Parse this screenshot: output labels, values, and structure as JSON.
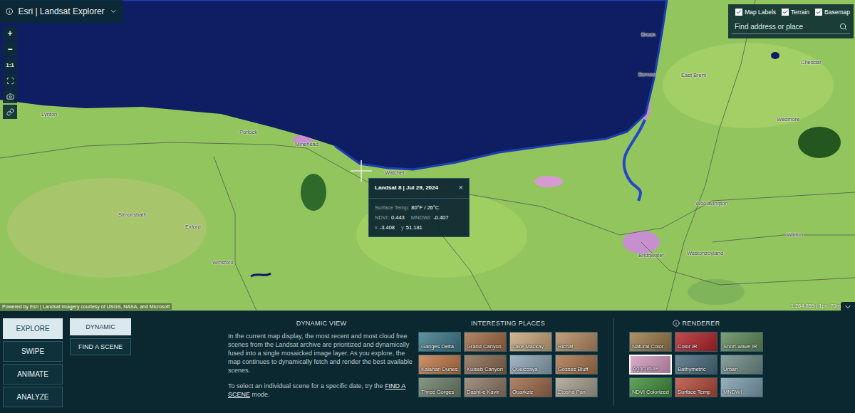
{
  "app": {
    "title": "Esri | Landsat Explorer"
  },
  "zoom_controls": [
    "+",
    "−",
    "1:1"
  ],
  "layers": [
    {
      "label": "Map Labels",
      "checked": true
    },
    {
      "label": "Terrain",
      "checked": true
    },
    {
      "label": "Basemap",
      "checked": true
    }
  ],
  "search": {
    "placeholder": "Find address or place"
  },
  "map_labels": [
    "Lynton",
    "Porlock",
    "Minehead",
    "Watchet",
    "Exford",
    "Simonsbath",
    "Winsford",
    "Bridgwater",
    "Westonzoyland",
    "Woolavington",
    "Walton",
    "Brean",
    "Berrow",
    "Wedmore",
    "Cheddar",
    "East Brent"
  ],
  "popup": {
    "title": "Landsat 8 | Jul 29, 2024",
    "close": "×",
    "surface_temp_label": "Surface Temp:",
    "surface_temp": "80°F / 26°C",
    "ndvi_label": "NDVI:",
    "ndvi": "0.443",
    "mndwi_label": "MNDWI:",
    "mndwi": "-0.407",
    "x_label": "x",
    "x": "-3.408",
    "y_label": "y",
    "y": "51.181"
  },
  "attribution": "Powered by Esri | Landsat imagery courtesy of USGS, NASA, and Microsoft",
  "scale": "1:264,859 | 1px: 70m",
  "modes": [
    {
      "label": "EXPLORE",
      "selected": true
    },
    {
      "label": "SWIPE",
      "selected": false
    },
    {
      "label": "ANIMATE",
      "selected": false
    },
    {
      "label": "ANALYZE",
      "selected": false
    }
  ],
  "submodes": [
    {
      "label": "DYNAMIC",
      "selected": true
    },
    {
      "label": "FIND A SCENE",
      "selected": false
    }
  ],
  "description": {
    "title": "DYNAMIC VIEW",
    "body": "In the current map display, the most recent and most cloud free scenes from the Landsat archive are prioritized and dynamically fused into a single mosaicked image layer. As you explore, the map continues to dynamically fetch and render the best available scenes.",
    "link_prefix": "To select an individual scene for a specific date, try the ",
    "link": "FIND A SCENE",
    "link_suffix": " mode."
  },
  "places": {
    "title": "INTERESTING PLACES",
    "items": [
      {
        "label": "Ganges Delta",
        "color": "#3e7a8a"
      },
      {
        "label": "Grand Canyon",
        "color": "#a26b45"
      },
      {
        "label": "Lake Mackay",
        "color": "#c9a77a"
      },
      {
        "label": "Richat",
        "color": "#b48a62"
      },
      {
        "label": "Kalahari Dunes",
        "color": "#c07a4a"
      },
      {
        "label": "Kuiseb Canyon",
        "color": "#8a6a50"
      },
      {
        "label": "Quelccaya",
        "color": "#8fa6b6"
      },
      {
        "label": "Gosses Bluff",
        "color": "#a9744c"
      },
      {
        "label": "Three Gorges",
        "color": "#6f7f6a"
      },
      {
        "label": "Dasht-e Kavir",
        "color": "#8f7a68"
      },
      {
        "label": "Ouarkziz",
        "color": "#9c6a48"
      },
      {
        "label": "Etosha Pan",
        "color": "#a8a090"
      }
    ]
  },
  "renderers": {
    "title": "RENDERER",
    "items": [
      {
        "label": "Natural Color",
        "selected": false,
        "color": "#9a7a4a"
      },
      {
        "label": "Color IR",
        "selected": false,
        "color": "#b3242a"
      },
      {
        "label": "Short-wave IR",
        "selected": false,
        "color": "#5e8a5a"
      },
      {
        "label": "Agriculture",
        "selected": true,
        "color": "#d49ac0"
      },
      {
        "label": "Bathymetric",
        "selected": false,
        "color": "#4b6b7e"
      },
      {
        "label": "Urban",
        "selected": false,
        "color": "#6f8c88"
      },
      {
        "label": "NDVI Colorized",
        "selected": false,
        "color": "#3f8f3a"
      },
      {
        "label": "Surface Temp",
        "selected": false,
        "color": "#b54a3a"
      },
      {
        "label": "MNDWI",
        "selected": false,
        "color": "#7f9fb0"
      }
    ]
  }
}
